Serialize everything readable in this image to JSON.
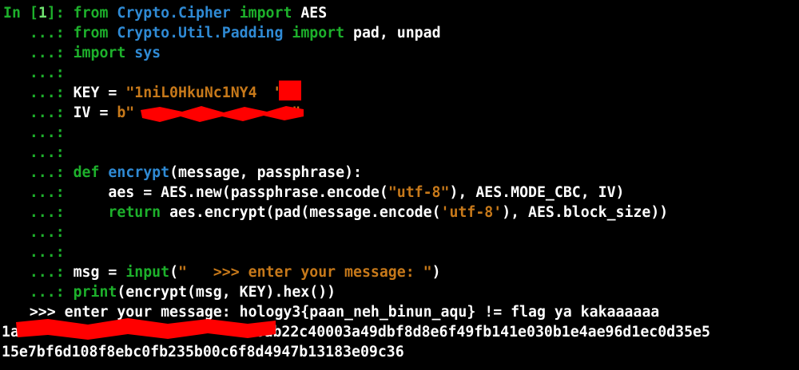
{
  "prompt": {
    "in_label": "In [",
    "cell_number": "1",
    "in_close": "]: ",
    "continuation": "   ...: "
  },
  "code_lines": [
    {
      "spans": [
        [
          "kw",
          "from"
        ],
        [
          "txt",
          " "
        ],
        [
          "mod",
          "Crypto.Cipher"
        ],
        [
          "txt",
          " "
        ],
        [
          "kw",
          "import"
        ],
        [
          "txt",
          " AES"
        ]
      ]
    },
    {
      "spans": [
        [
          "kw",
          "from"
        ],
        [
          "txt",
          " "
        ],
        [
          "mod",
          "Crypto.Util.Padding"
        ],
        [
          "txt",
          " "
        ],
        [
          "kw",
          "import"
        ],
        [
          "txt",
          " pad, unpad"
        ]
      ]
    },
    {
      "spans": [
        [
          "kw",
          "import"
        ],
        [
          "txt",
          " "
        ],
        [
          "mod",
          "sys"
        ]
      ]
    },
    {
      "spans": []
    },
    {
      "spans": [
        [
          "txt",
          "KEY = "
        ],
        [
          "str",
          "\"1niL0HkuNc1NY4  \""
        ]
      ]
    },
    {
      "spans": [
        [
          "txt",
          "IV = "
        ],
        [
          "str",
          "b\"                  \""
        ]
      ]
    },
    {
      "spans": []
    },
    {
      "spans": []
    },
    {
      "spans": [
        [
          "kw",
          "def"
        ],
        [
          "txt",
          " "
        ],
        [
          "fn",
          "encrypt"
        ],
        [
          "txt",
          "(message, passphrase):"
        ]
      ]
    },
    {
      "spans": [
        [
          "txt",
          "    aes = AES.new(passphrase.encode("
        ],
        [
          "str",
          "\"utf-8\""
        ],
        [
          "txt",
          "), AES.MODE_CBC, IV)"
        ]
      ]
    },
    {
      "spans": [
        [
          "txt",
          "    "
        ],
        [
          "kw",
          "return"
        ],
        [
          "txt",
          " aes.encrypt(pad(message.encode("
        ],
        [
          "str",
          "'utf-8'"
        ],
        [
          "txt",
          "), AES.block_size))"
        ]
      ]
    },
    {
      "spans": []
    },
    {
      "spans": []
    },
    {
      "spans": [
        [
          "txt",
          "msg = "
        ],
        [
          "bi",
          "input"
        ],
        [
          "txt",
          "("
        ],
        [
          "str",
          "\"   >>> enter your message: \""
        ],
        [
          "txt",
          ")"
        ]
      ]
    },
    {
      "spans": [
        [
          "bi",
          "print"
        ],
        [
          "txt",
          "(encrypt(msg, KEY).hex())"
        ]
      ]
    }
  ],
  "output_lines": [
    "   >>> enter your message: hology3{paan_neh_binun_aqu} != flag ya kakaaaaaa",
    "1a                           6ab22c40003a49dbf8d8e6f49fb141e030b1e4ae96d1ec0d35e5",
    "15e7bf6d108f8ebc0fb235b00c6f8d4947b13183e09c36"
  ],
  "colors": {
    "background": "#000000",
    "prompt_green": "#1db02b",
    "keyword_green": "#1db02b",
    "module_blue": "#2f8ad4",
    "string_orange": "#c7791a",
    "text_white": "#ffffff",
    "redaction_red": "#ff0000"
  }
}
